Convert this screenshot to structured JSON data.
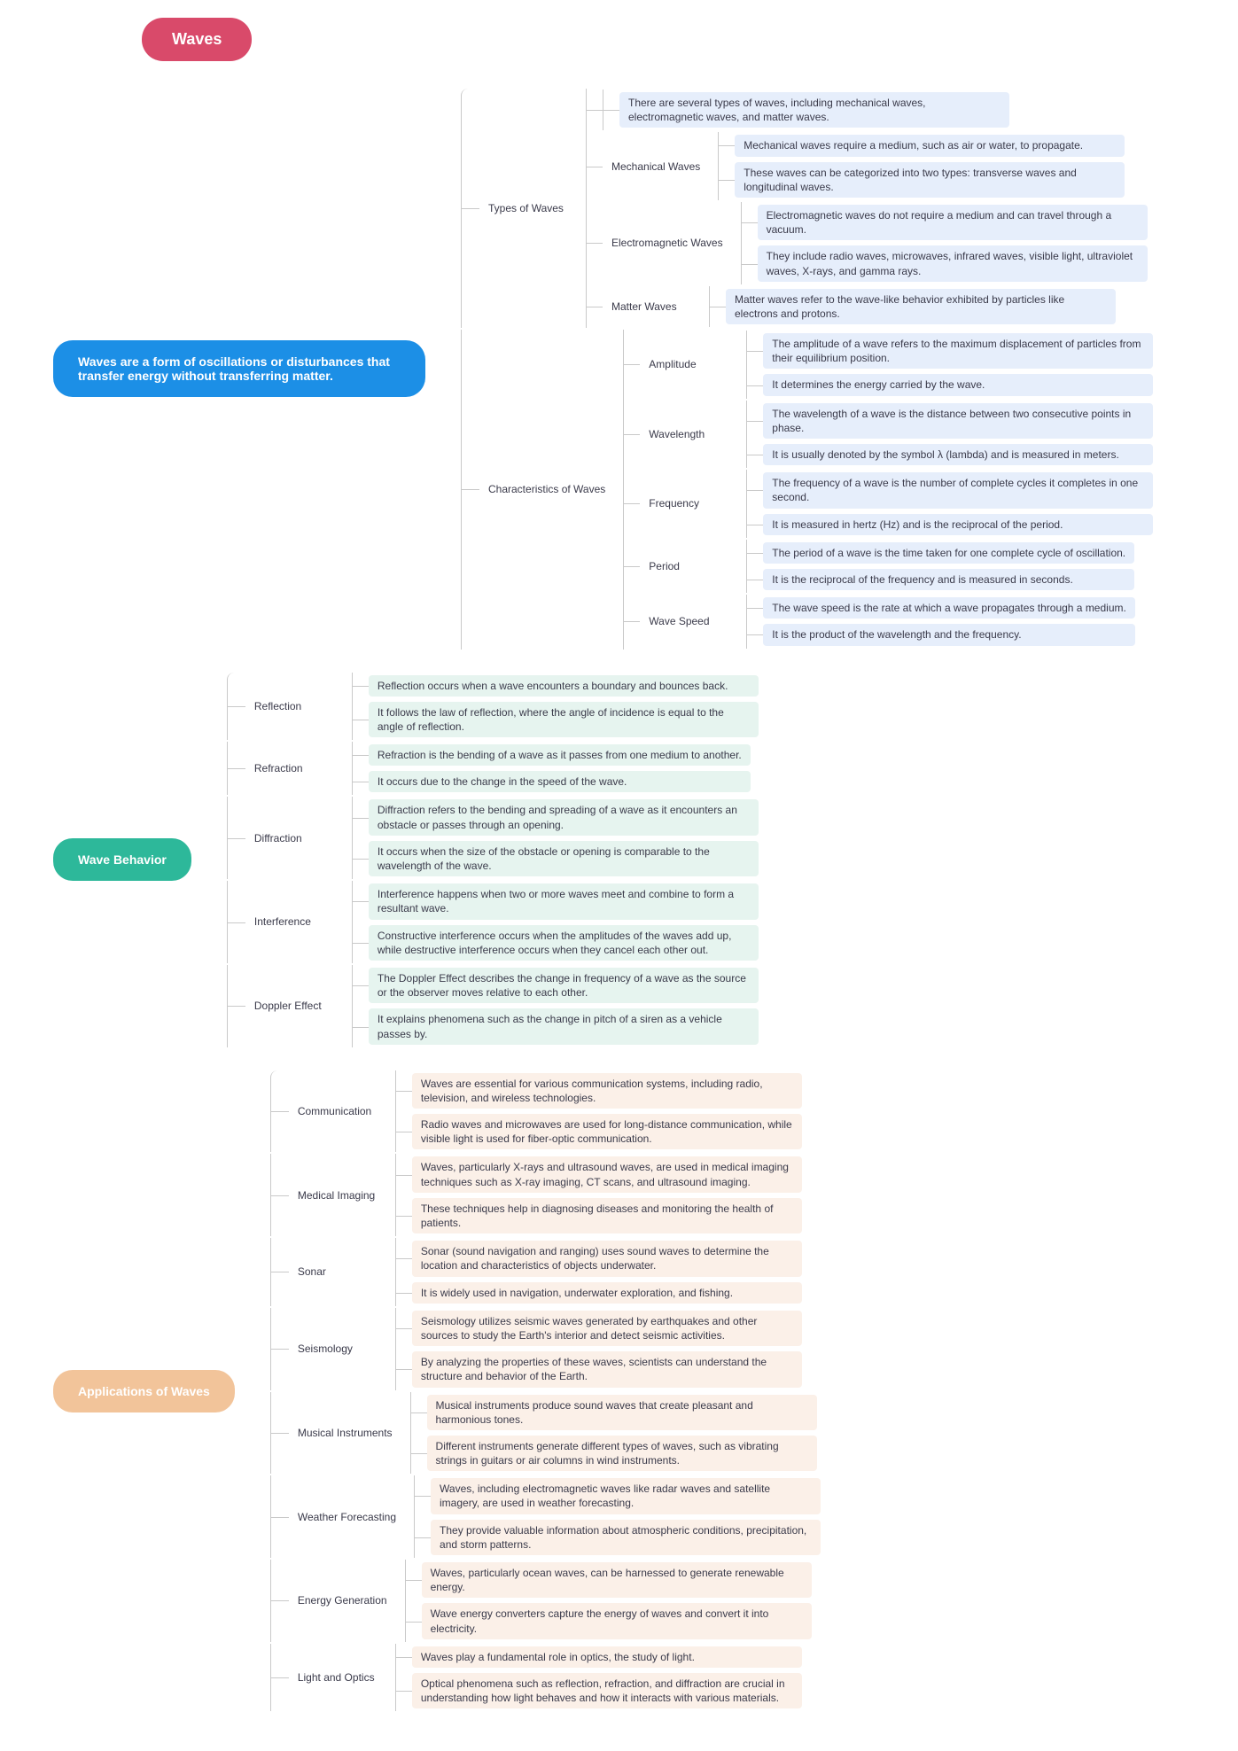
{
  "root": "Waves",
  "chapters": [
    {
      "title": "Waves are a form of oscillations or disturbances that transfer energy without transferring matter.",
      "color": "blue",
      "sections": [
        {
          "label": "Types of Waves",
          "children": [
            {
              "leaf": "There are several types of waves, including mechanical waves, electromagnetic waves, and matter waves."
            },
            {
              "label": "Mechanical Waves",
              "leaves": [
                "Mechanical waves require a medium, such as air or water, to propagate.",
                "These waves can be categorized into two types: transverse waves and longitudinal waves."
              ]
            },
            {
              "label": "Electromagnetic Waves",
              "leaves": [
                "Electromagnetic waves do not require a medium and can travel through a vacuum.",
                "They include radio waves, microwaves, infrared waves, visible light, ultraviolet waves, X-rays, and gamma rays."
              ]
            },
            {
              "label": "Matter Waves",
              "leaves": [
                "Matter waves refer to the wave-like behavior exhibited by particles like electrons and protons."
              ]
            }
          ]
        },
        {
          "label": "Characteristics of Waves",
          "children": [
            {
              "label": "Amplitude",
              "leaves": [
                "The amplitude of a wave refers to the maximum displacement of particles from their equilibrium position.",
                "It determines the energy carried by the wave."
              ]
            },
            {
              "label": "Wavelength",
              "leaves": [
                "The wavelength of a wave is the distance between two consecutive points in phase.",
                "It is usually denoted by the symbol λ (lambda) and is measured in meters."
              ]
            },
            {
              "label": "Frequency",
              "leaves": [
                "The frequency of a wave is the number of complete cycles it completes in one second.",
                "It is measured in hertz (Hz) and is the reciprocal of the period."
              ]
            },
            {
              "label": "Period",
              "leaves": [
                "The period of a wave is the time taken for one complete cycle of oscillation.",
                "It is the reciprocal of the frequency and is measured in seconds."
              ]
            },
            {
              "label": "Wave Speed",
              "leaves": [
                "The wave speed is the rate at which a wave propagates through a medium.",
                "It is the product of the wavelength and the frequency."
              ]
            }
          ]
        }
      ]
    },
    {
      "title": "Wave Behavior",
      "color": "teal",
      "sections": [
        {
          "label": "Reflection",
          "leaves": [
            "Reflection occurs when a wave encounters a boundary and bounces back.",
            "It follows the law of reflection, where the angle of incidence is equal to the angle of reflection."
          ]
        },
        {
          "label": "Refraction",
          "leaves": [
            "Refraction is the bending of a wave as it passes from one medium to another.",
            "It occurs due to the change in the speed of the wave."
          ]
        },
        {
          "label": "Diffraction",
          "leaves": [
            "Diffraction refers to the bending and spreading of a wave as it encounters an obstacle or passes through an opening.",
            "It occurs when the size of the obstacle or opening is comparable to the wavelength of the wave."
          ]
        },
        {
          "label": "Interference",
          "leaves": [
            "Interference happens when two or more waves meet and combine to form a resultant wave.",
            "Constructive interference occurs when the amplitudes of the waves add up, while destructive interference occurs when they cancel each other out."
          ]
        },
        {
          "label": "Doppler Effect",
          "leaves": [
            "The Doppler Effect describes the change in frequency of a wave as the source or the observer moves relative to each other.",
            "It explains phenomena such as the change in pitch of a siren as a vehicle passes by."
          ]
        }
      ]
    },
    {
      "title": "Applications of Waves",
      "color": "peach",
      "sections": [
        {
          "label": "Communication",
          "leaves": [
            "Waves are essential for various communication systems, including radio, television, and wireless technologies.",
            "Radio waves and microwaves are used for long-distance communication, while visible light is used for fiber-optic communication."
          ]
        },
        {
          "label": "Medical Imaging",
          "leaves": [
            "Waves, particularly X-rays and ultrasound waves, are used in medical imaging techniques such as X-ray imaging, CT scans, and ultrasound imaging.",
            "These techniques help in diagnosing diseases and monitoring the health of patients."
          ]
        },
        {
          "label": "Sonar",
          "leaves": [
            "Sonar (sound navigation and ranging) uses sound waves to determine the location and characteristics of objects underwater.",
            "It is widely used in navigation, underwater exploration, and fishing."
          ]
        },
        {
          "label": "Seismology",
          "leaves": [
            "Seismology utilizes seismic waves generated by earthquakes and other sources to study the Earth's interior and detect seismic activities.",
            "By analyzing the properties of these waves, scientists can understand the structure and behavior of the Earth."
          ]
        },
        {
          "label": "Musical Instruments",
          "leaves": [
            "Musical instruments produce sound waves that create pleasant and harmonious tones.",
            "Different instruments generate different types of waves, such as vibrating strings in guitars or air columns in wind instruments."
          ]
        },
        {
          "label": "Weather Forecasting",
          "leaves": [
            "Waves, including electromagnetic waves like radar waves and satellite imagery, are used in weather forecasting.",
            "They provide valuable information about atmospheric conditions, precipitation, and storm patterns."
          ]
        },
        {
          "label": "Energy Generation",
          "leaves": [
            "Waves, particularly ocean waves, can be harnessed to generate renewable energy.",
            "Wave energy converters capture the energy of waves and convert it into electricity."
          ]
        },
        {
          "label": "Light and Optics",
          "leaves": [
            "Waves play a fundamental role in optics, the study of light.",
            "Optical phenomena such as reflection, refraction, and diffraction are crucial in understanding how light behaves and how it interacts with various materials."
          ]
        }
      ]
    }
  ]
}
